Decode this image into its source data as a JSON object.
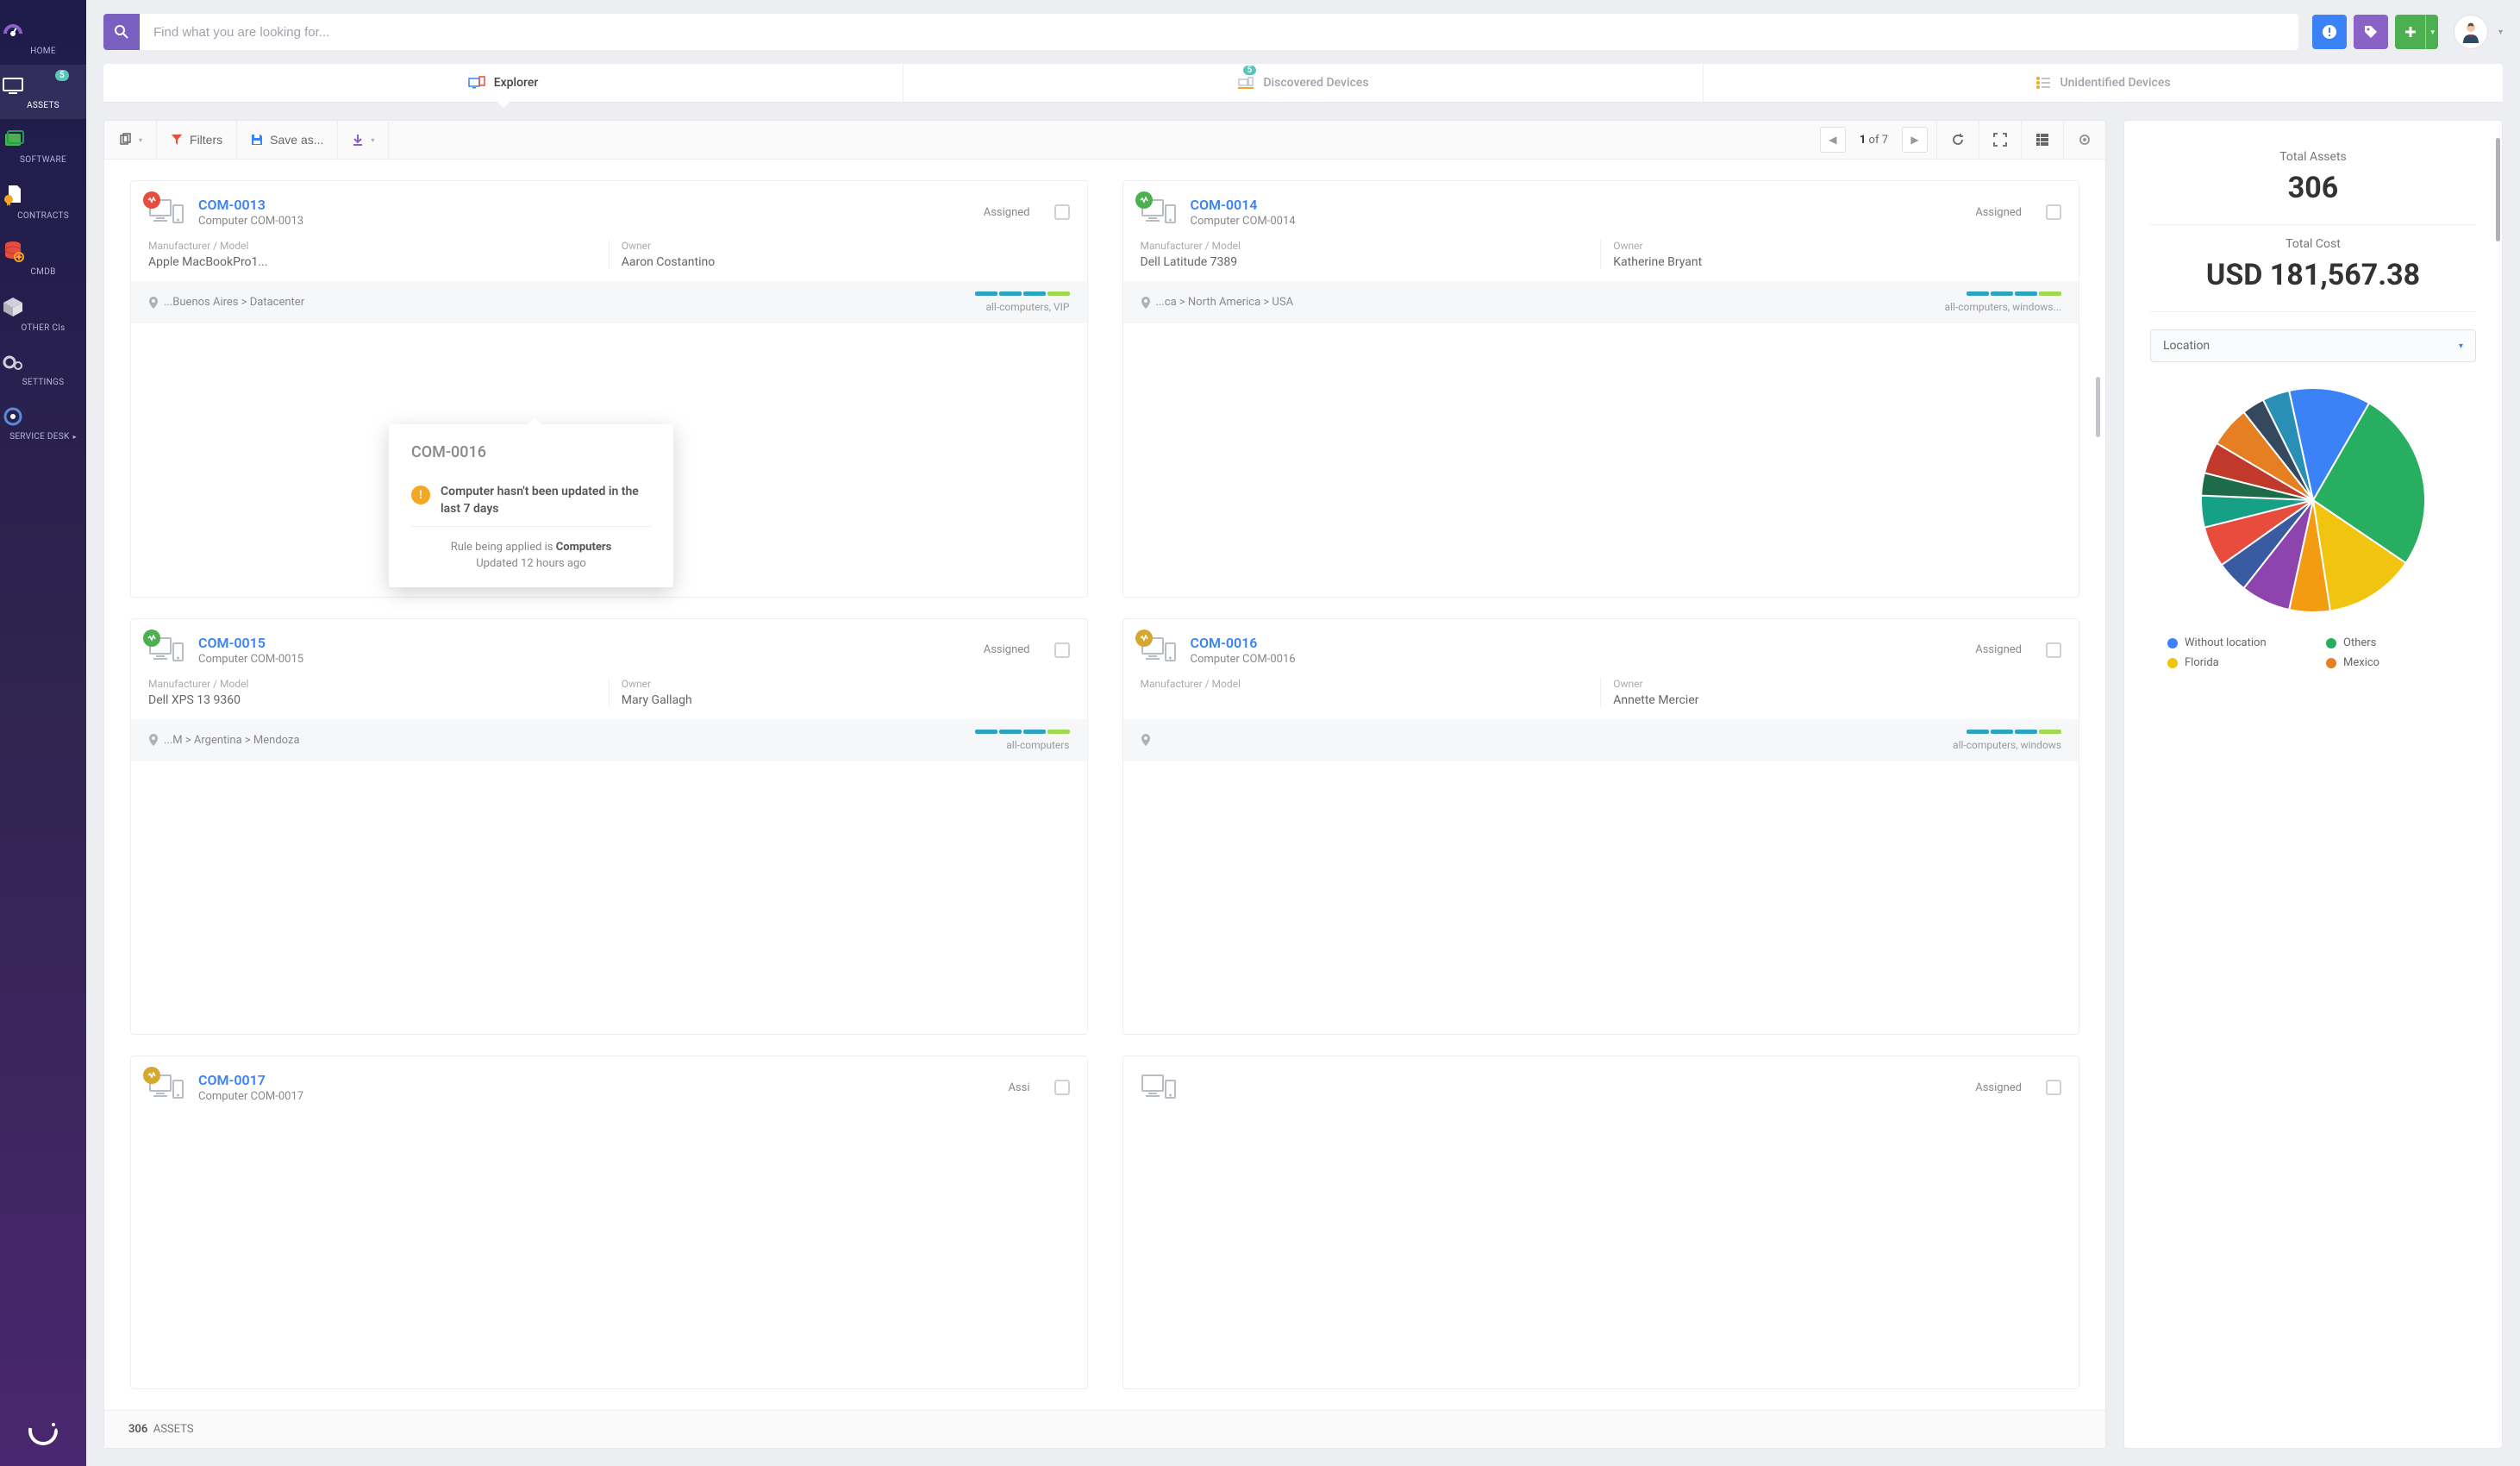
{
  "search": {
    "placeholder": "Find what you are looking for..."
  },
  "sidebar": {
    "items": [
      {
        "label": "HOME"
      },
      {
        "label": "ASSETS",
        "badge": "5"
      },
      {
        "label": "SOFTWARE"
      },
      {
        "label": "CONTRACTS"
      },
      {
        "label": "CMDB"
      },
      {
        "label": "OTHER CIs"
      },
      {
        "label": "SETTINGS"
      },
      {
        "label": "SERVICE DESK"
      }
    ]
  },
  "tabs": {
    "explorer": "Explorer",
    "discovered": "Discovered Devices",
    "discovered_badge": "5",
    "unidentified": "Unidentified Devices"
  },
  "toolbar": {
    "filters": "Filters",
    "saveas": "Save as...",
    "pager_current": "1",
    "pager_of": "of 7"
  },
  "cards": [
    {
      "id": "COM-0013",
      "name": "Computer COM-0013",
      "state": "Assigned",
      "status": "red",
      "mfr_label": "Manufacturer / Model",
      "mfr": "Apple MacBookPro1...",
      "owner_label": "Owner",
      "owner": "Aaron Costantino",
      "loc": "...Buenos Aires > Datacenter",
      "tags": "all-computers, VIP",
      "bars": [
        "#2da3c4",
        "#2da3c4",
        "#2da3c4",
        "#a0d850"
      ]
    },
    {
      "id": "COM-0014",
      "name": "Computer COM-0014",
      "state": "Assigned",
      "status": "green",
      "mfr_label": "Manufacturer / Model",
      "mfr": "Dell Latitude 7389",
      "owner_label": "Owner",
      "owner": "Katherine Bryant",
      "loc": "...ca > North America > USA",
      "tags": "all-computers, windows...",
      "bars": [
        "#2da3c4",
        "#2da3c4",
        "#2da3c4",
        "#a0d850"
      ]
    },
    {
      "id": "COM-0015",
      "name": "Computer COM-0015",
      "state": "Assigned",
      "status": "green",
      "mfr_label": "Manufacturer / Model",
      "mfr": "Dell XPS 13 9360",
      "owner_label": "Owner",
      "owner": "Mary Gallagh",
      "loc": "...M > Argentina > Mendoza",
      "tags": "all-computers",
      "bars": [
        "#2da3c4",
        "#2da3c4",
        "#2da3c4",
        "#a0d850"
      ]
    },
    {
      "id": "COM-0016",
      "name": "Computer COM-0016",
      "state": "Assigned",
      "status": "yellow",
      "mfr_label": "Manufacturer / Model",
      "mfr": "",
      "owner_label": "Owner",
      "owner": "Annette Mercier",
      "loc": "",
      "tags": "all-computers, windows",
      "bars": [
        "#2da3c4",
        "#2da3c4",
        "#2da3c4",
        "#a0d850"
      ]
    },
    {
      "id": "COM-0017",
      "name": "Computer COM-0017",
      "state": "Assi",
      "status": "yellow",
      "mfr_label": "",
      "mfr": "",
      "owner_label": "",
      "owner": "",
      "loc": "",
      "tags": "",
      "bars": []
    },
    {
      "id": "",
      "name": "",
      "state": "Assigned",
      "status": "",
      "mfr_label": "",
      "mfr": "",
      "owner_label": "",
      "owner": "",
      "loc": "",
      "tags": "",
      "bars": []
    }
  ],
  "statusbar": {
    "count": "306",
    "label": "ASSETS"
  },
  "popover": {
    "title": "COM-0016",
    "message": "Computer hasn't been updated in the last 7 days",
    "rule_prefix": "Rule being applied is ",
    "rule": "Computers",
    "updated": "Updated 12 hours ago"
  },
  "side": {
    "total_assets_label": "Total Assets",
    "total_assets": "306",
    "total_cost_label": "Total Cost",
    "total_cost": "USD 181,567.38",
    "select": "Location",
    "legend": [
      {
        "label": "Without location",
        "color": "#3b82f6"
      },
      {
        "label": "Others",
        "color": "#27ae60"
      },
      {
        "label": "Florida",
        "color": "#f1c40f"
      },
      {
        "label": "Mexico",
        "color": "#e67e22"
      }
    ]
  },
  "chart_data": {
    "type": "pie",
    "title": "Assets by Location",
    "slices": [
      {
        "label": "Others",
        "value": 80,
        "color": "#27ae60"
      },
      {
        "label": "Florida",
        "value": 40,
        "color": "#f1c40f"
      },
      {
        "label": "Slice",
        "value": 18,
        "color": "#f39c12"
      },
      {
        "label": "Slice",
        "value": 22,
        "color": "#8e44ad"
      },
      {
        "label": "Slice",
        "value": 14,
        "color": "#3a5ba0"
      },
      {
        "label": "Slice",
        "value": 18,
        "color": "#e74c3c"
      },
      {
        "label": "Slice",
        "value": 14,
        "color": "#16a085"
      },
      {
        "label": "Slice",
        "value": 10,
        "color": "#1e6b4a"
      },
      {
        "label": "Slice",
        "value": 14,
        "color": "#c0392b"
      },
      {
        "label": "Mexico",
        "value": 18,
        "color": "#e67e22"
      },
      {
        "label": "Slice",
        "value": 10,
        "color": "#34495e"
      },
      {
        "label": "Slice",
        "value": 12,
        "color": "#2a8fb5"
      },
      {
        "label": "Without location",
        "value": 36,
        "color": "#3b82f6"
      }
    ]
  }
}
